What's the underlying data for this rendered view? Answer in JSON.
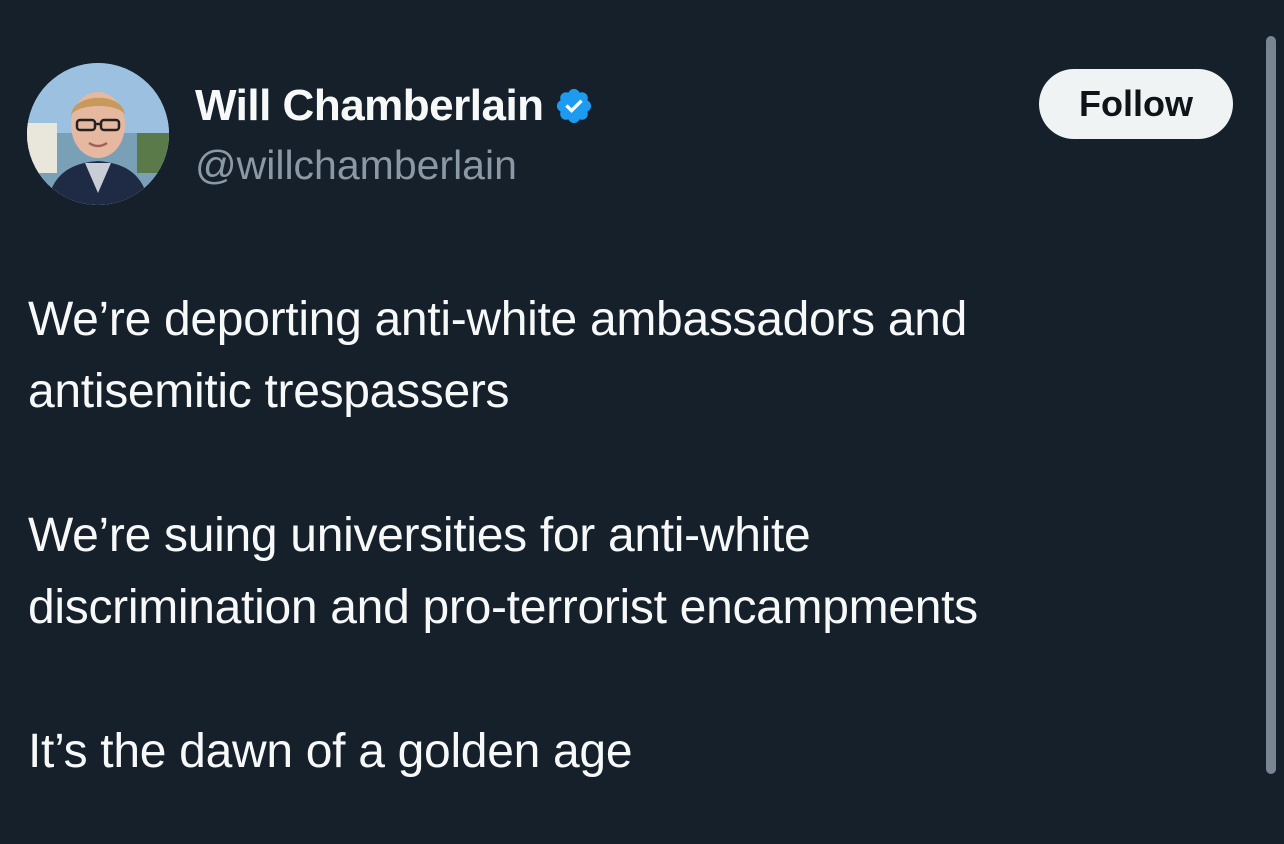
{
  "user": {
    "display_name": "Will Chamberlain",
    "handle": "@willchamberlain",
    "verified_icon": "verified-badge-icon"
  },
  "actions": {
    "follow_label": "Follow"
  },
  "tweet": {
    "lines": [
      "We’re deporting anti-white ambassadors and",
      "antisemitic trespassers",
      "We’re suing universities for anti-white",
      "discrimination and pro-terrorist encampments",
      "It’s the dawn of a golden age"
    ]
  },
  "colors": {
    "background": "#15202b",
    "text": "#f7f9f9",
    "secondary_text": "#8b98a5",
    "verified_blue": "#1d9bf0",
    "button_bg": "#eff3f4"
  }
}
